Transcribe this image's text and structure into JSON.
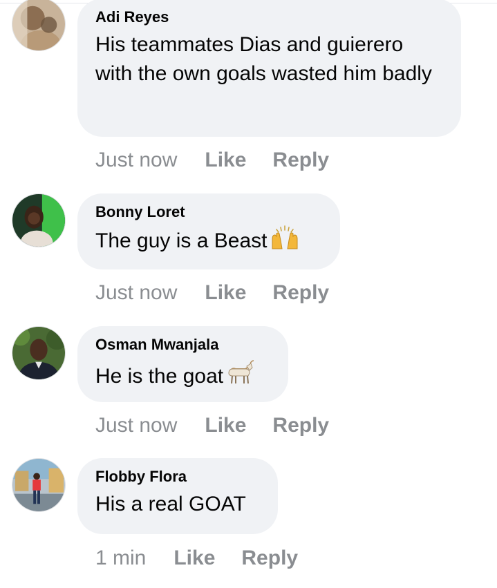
{
  "comments": [
    {
      "author": "Adi Reyes",
      "text": "His teammates Dias and guierero with the own goals wasted him badly",
      "emoji": "",
      "time": "Just now",
      "like_label": "Like",
      "reply_label": "Reply"
    },
    {
      "author": "Bonny Loret",
      "text": "The guy is a Beast",
      "emoji": "raising-hands-emoji",
      "time": "Just now",
      "like_label": "Like",
      "reply_label": "Reply"
    },
    {
      "author": "Osman Mwanjala",
      "text": "He is the goat",
      "emoji": "goat-emoji",
      "time": "Just now",
      "like_label": "Like",
      "reply_label": "Reply"
    },
    {
      "author": "Flobby Flora",
      "text": "His a real GOAT",
      "emoji": "",
      "time": "1 min",
      "like_label": "Like",
      "reply_label": "Reply"
    }
  ],
  "colors": {
    "bubble": "#f0f2f5",
    "meta_text": "#8a8d91",
    "body_text": "#050505"
  }
}
